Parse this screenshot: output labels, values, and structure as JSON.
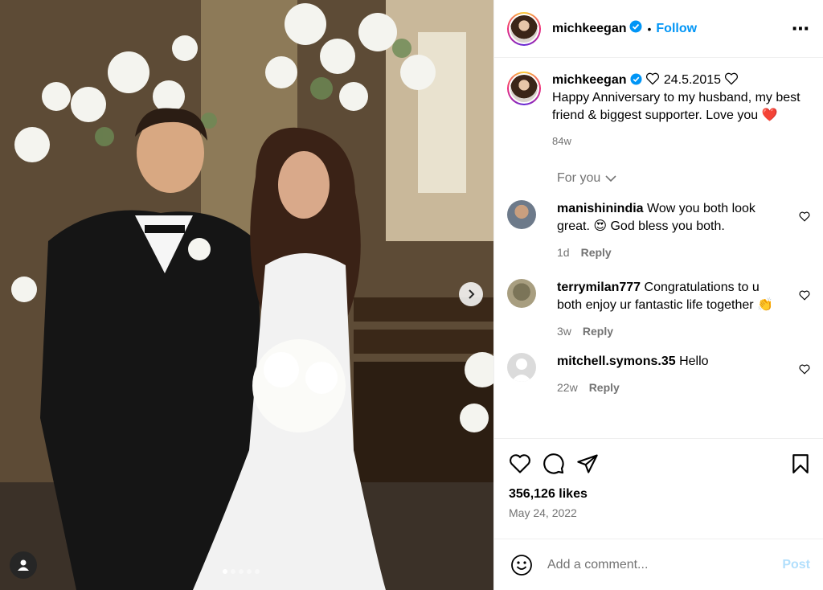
{
  "post": {
    "username": "michkeegan",
    "follow_label": "Follow",
    "more_icon": "more-horizontal-icon",
    "separator": "•"
  },
  "caption": {
    "username": "michkeegan",
    "date_text": "24.5.2015",
    "text": "Happy Anniversary to my husband, my best friend & biggest supporter. Love you",
    "emoji": "❤️",
    "age": "84w"
  },
  "for_you_label": "For you",
  "comments": [
    {
      "username": "manishinindia",
      "text": "Wow you both look great. 😍 God bless you both.",
      "age": "1d",
      "reply_label": "Reply"
    },
    {
      "username": "terrymilan777",
      "text": "Congratulations to u both enjoy ur fantastic life together 👏",
      "age": "3w",
      "reply_label": "Reply"
    },
    {
      "username": "mitchell.symons.35",
      "text": "Hello",
      "age": "22w",
      "reply_label": "Reply"
    }
  ],
  "actions": {
    "likes": "356,126 likes",
    "date": "May 24, 2022"
  },
  "add_comment": {
    "placeholder": "Add a comment...",
    "post_label": "Post"
  },
  "carousel": {
    "total": 5,
    "active": 0
  },
  "colors": {
    "accent": "#0095f6",
    "post_disabled": "#b2dffc",
    "muted": "#737373"
  }
}
